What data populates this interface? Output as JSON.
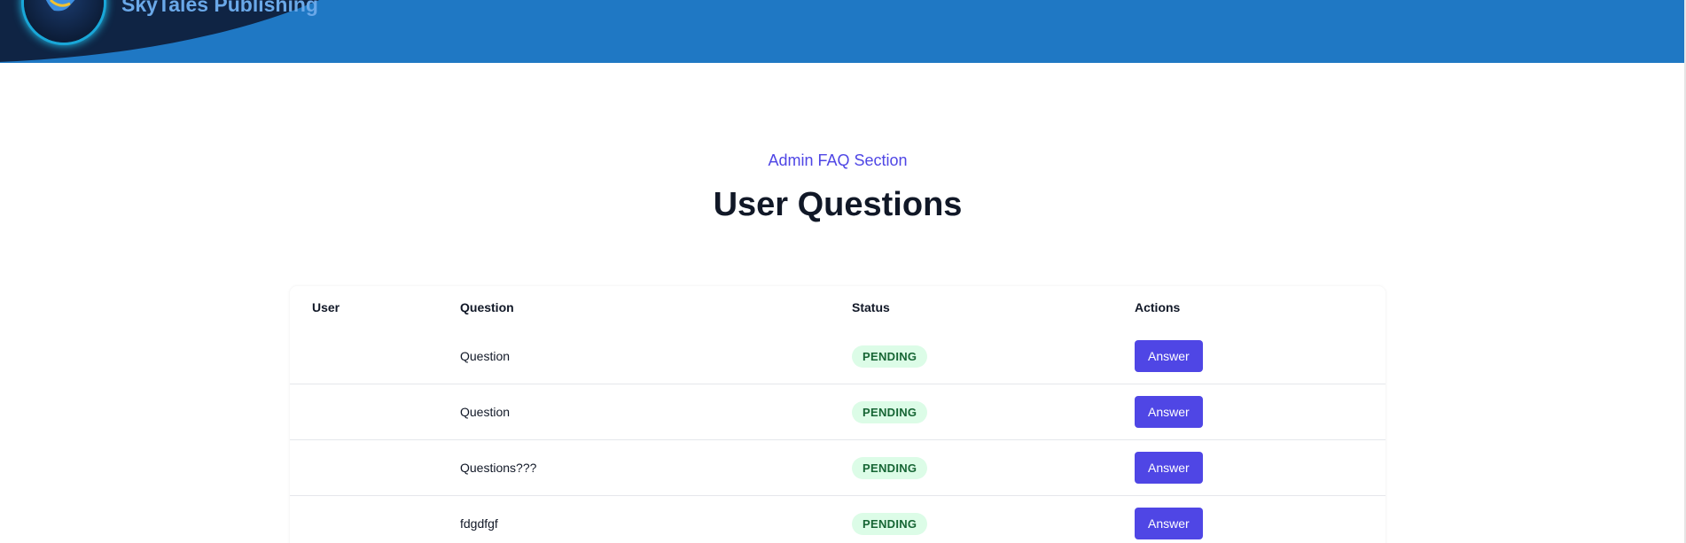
{
  "header": {
    "brand": "SkyTales Publishing",
    "colors": {
      "bar": "#1f78c4",
      "dark": "#0f2444",
      "brand_text": "#6aa8e8"
    }
  },
  "intro": {
    "eyebrow": "Admin FAQ Section",
    "title": "User Questions"
  },
  "table": {
    "columns": [
      "User",
      "Question",
      "Status",
      "Actions"
    ],
    "rows": [
      {
        "user": "",
        "question": "Question",
        "status": "PENDING",
        "action": "Answer"
      },
      {
        "user": "",
        "question": "Question",
        "status": "PENDING",
        "action": "Answer"
      },
      {
        "user": "",
        "question": "Questions???",
        "status": "PENDING",
        "action": "Answer"
      },
      {
        "user": "",
        "question": "fdgdfgf",
        "status": "PENDING",
        "action": "Answer"
      }
    ]
  },
  "colors": {
    "accent": "#4f46e5",
    "badge_bg": "#dcfce7",
    "badge_text": "#166534"
  }
}
